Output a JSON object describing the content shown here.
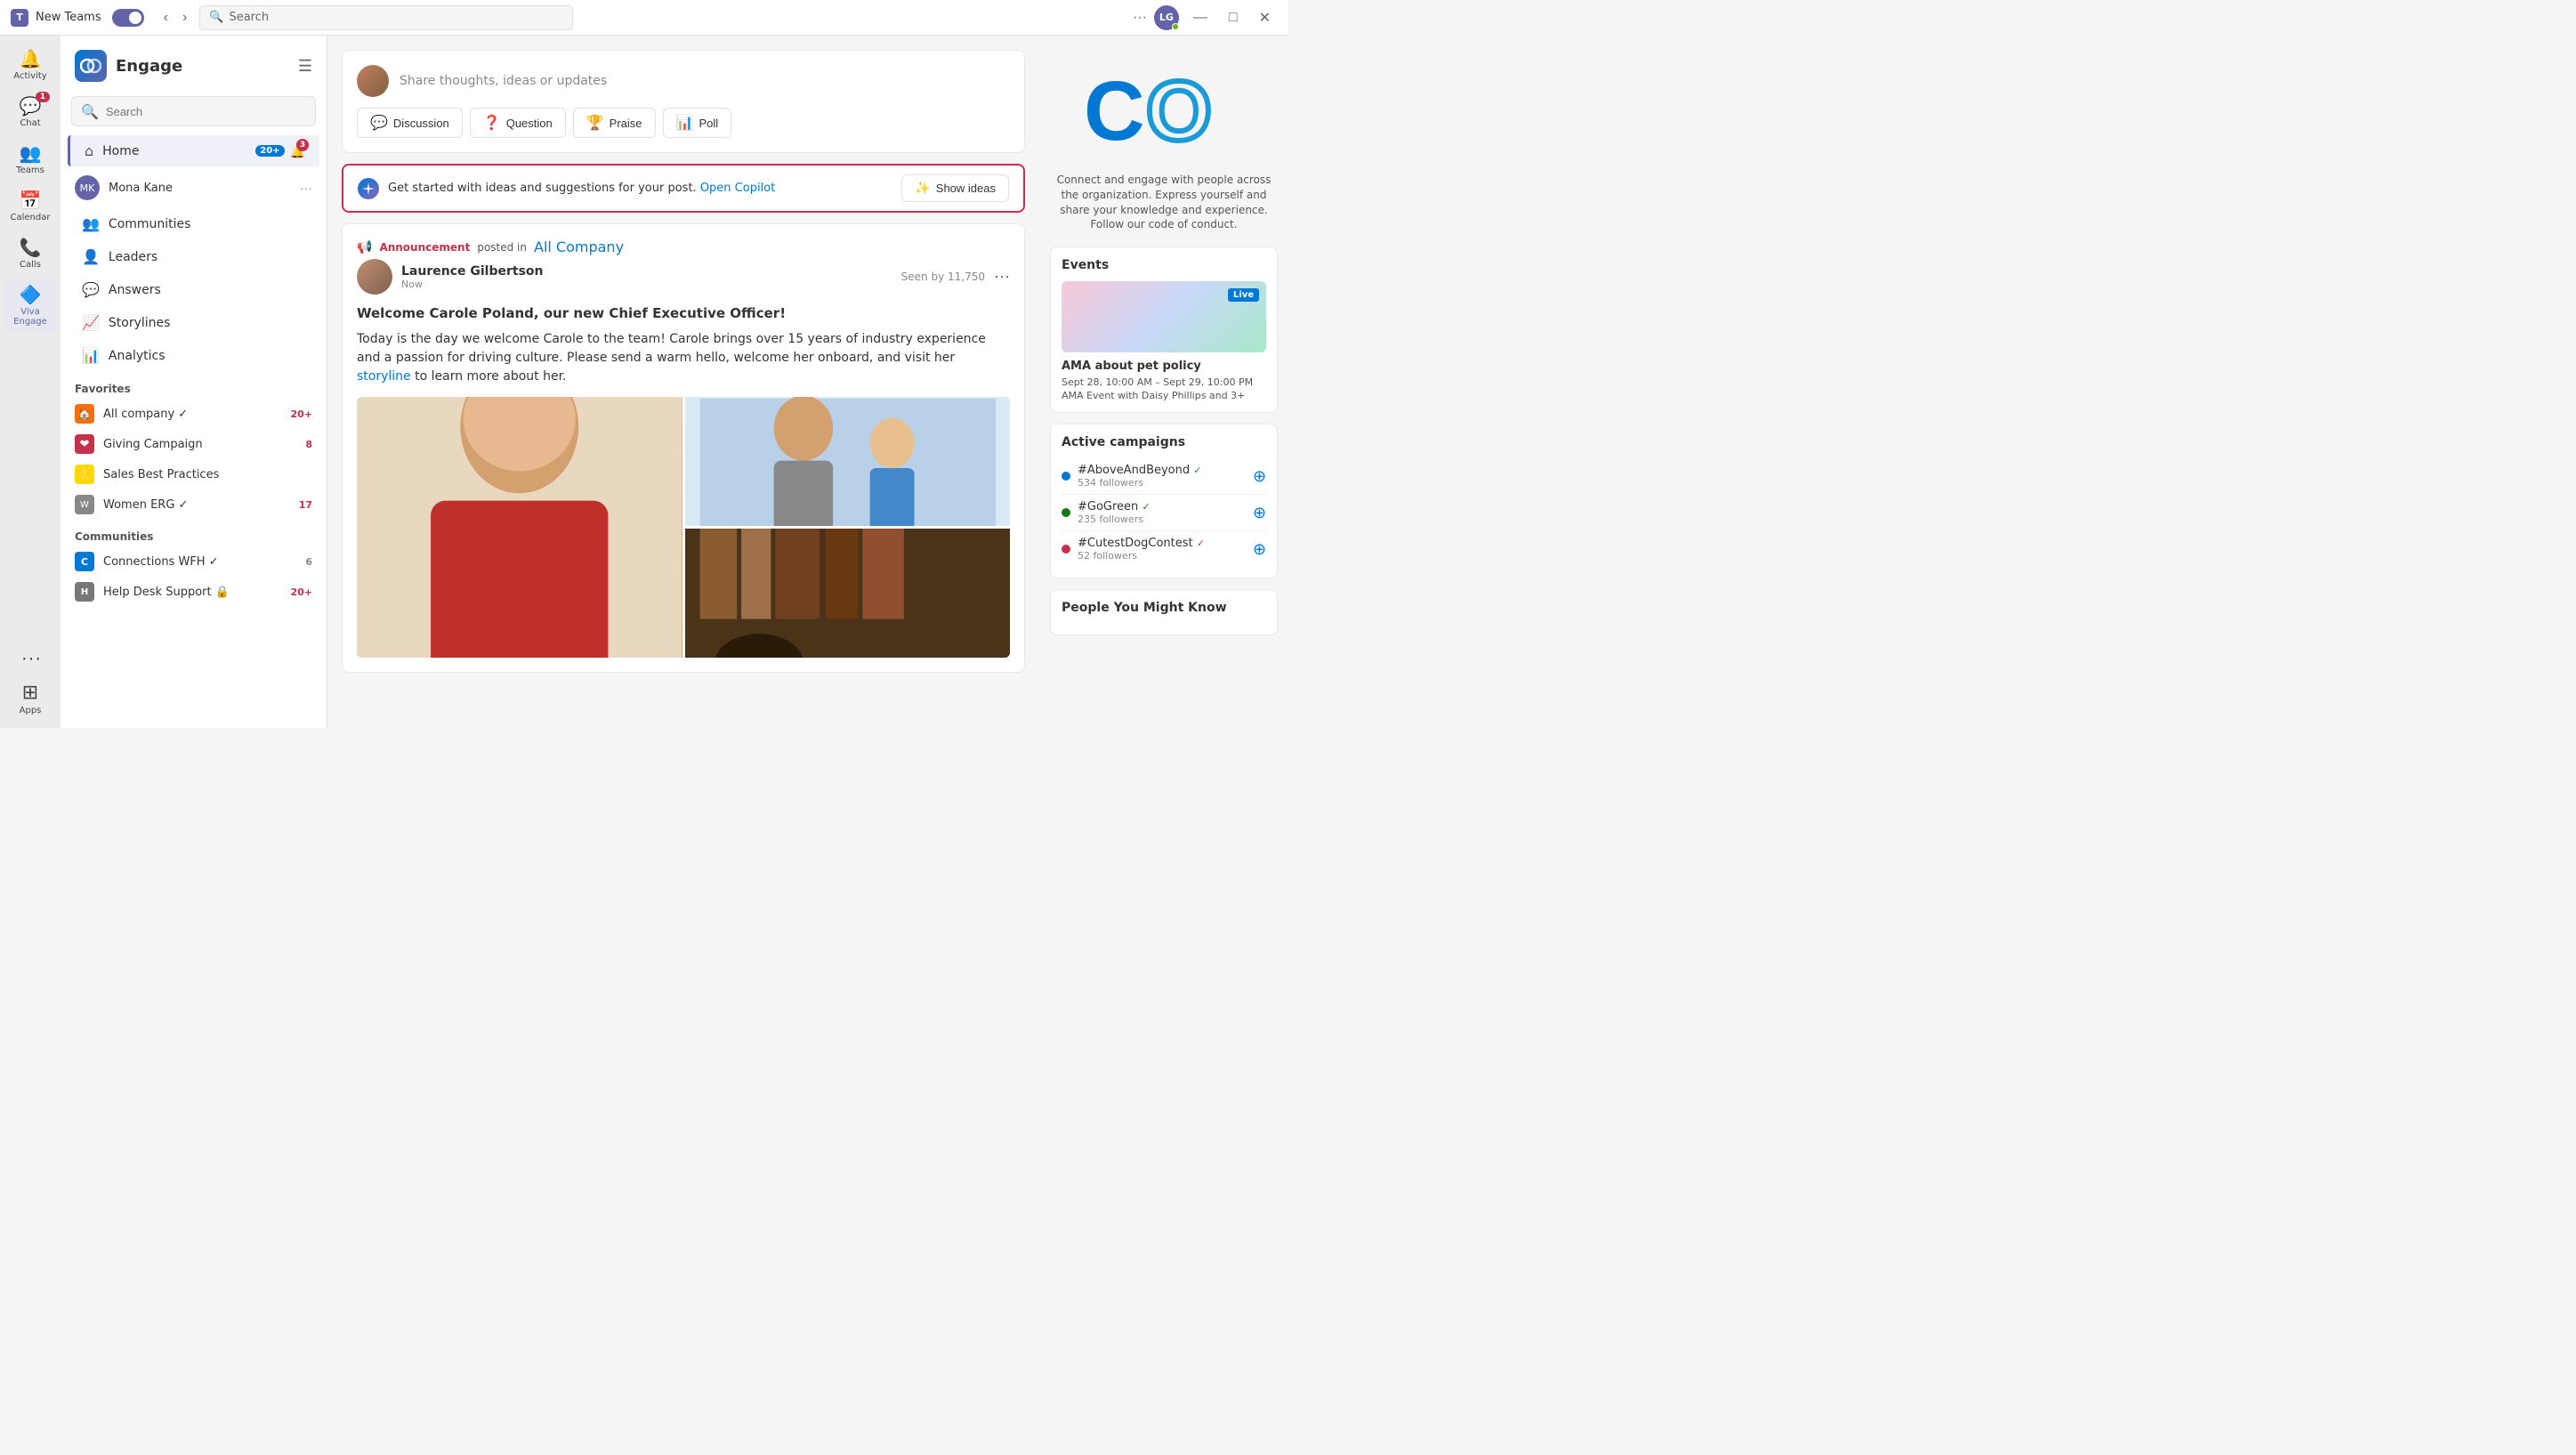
{
  "titleBar": {
    "appName": "New Teams",
    "searchPlaceholder": "Search",
    "avatarInitials": "LG",
    "minimize": "—",
    "maximize": "□",
    "close": "✕",
    "more": "···"
  },
  "leftRail": {
    "items": [
      {
        "id": "activity",
        "label": "Activity",
        "icon": "🔔",
        "badge": null
      },
      {
        "id": "chat",
        "label": "Chat",
        "icon": "💬",
        "badge": "1"
      },
      {
        "id": "teams",
        "label": "Teams",
        "icon": "👥",
        "badge": null
      },
      {
        "id": "calendar",
        "label": "Calendar",
        "icon": "📅",
        "badge": null
      },
      {
        "id": "calls",
        "label": "Calls",
        "icon": "📞",
        "badge": null
      },
      {
        "id": "viva-engage",
        "label": "Viva Engage",
        "icon": "🔷",
        "badge": null
      }
    ],
    "bottomItems": [
      {
        "id": "more",
        "label": "···",
        "icon": "···",
        "badge": null
      },
      {
        "id": "apps",
        "label": "Apps",
        "icon": "+",
        "badge": null
      }
    ]
  },
  "sidebar": {
    "title": "Engage",
    "searchPlaceholder": "Search",
    "navItems": [
      {
        "id": "home",
        "label": "Home",
        "icon": "⌂",
        "badgeCount": "20+",
        "bellCount": "3",
        "active": true
      },
      {
        "id": "communities",
        "label": "Communities",
        "icon": "👥",
        "badge": null
      },
      {
        "id": "leaders",
        "label": "Leaders",
        "icon": "👤",
        "badge": null
      },
      {
        "id": "answers",
        "label": "Answers",
        "icon": "💬",
        "badge": null
      },
      {
        "id": "storylines",
        "label": "Storylines",
        "icon": "📈",
        "badge": null
      },
      {
        "id": "analytics",
        "label": "Analytics",
        "icon": "📊",
        "badge": null
      }
    ],
    "user": {
      "name": "Mona Kane",
      "avatar": ""
    },
    "favorites": {
      "title": "Favorites",
      "items": [
        {
          "id": "all-company",
          "name": "All company",
          "icon": "🏠",
          "iconBg": "orange",
          "badgeCount": "20+",
          "verified": true
        },
        {
          "id": "giving-campaign",
          "name": "Giving Campaign",
          "icon": "❤",
          "iconBg": "red",
          "badgeCount": "8"
        },
        {
          "id": "sales-best",
          "name": "Sales Best Practices",
          "icon": "⭐",
          "iconBg": "yellow",
          "badgeCount": null
        },
        {
          "id": "women-erg",
          "name": "Women ERG",
          "icon": "👤",
          "iconBg": "gray",
          "badgeCount": "17",
          "verified": true
        }
      ]
    },
    "communities": {
      "title": "Communities",
      "items": [
        {
          "id": "connections-wfh",
          "name": "Connections WFH",
          "icon": "C",
          "iconBg": "#0078d4",
          "badgeCount": "6",
          "verified": true
        },
        {
          "id": "help-desk",
          "name": "Help Desk Support",
          "icon": "H",
          "iconBg": "#555",
          "badgeCount": "20+",
          "locked": true
        }
      ]
    }
  },
  "composer": {
    "placeholder": "Share thoughts, ideas or updates",
    "buttons": [
      {
        "id": "discussion",
        "label": "Discussion",
        "color": "orange"
      },
      {
        "id": "question",
        "label": "Question",
        "color": "blue"
      },
      {
        "id": "praise",
        "label": "Praise",
        "color": "purple"
      },
      {
        "id": "poll",
        "label": "Poll",
        "color": "green"
      }
    ]
  },
  "copilotBar": {
    "text": "Get started with ideas and suggestions for your post.",
    "linkText": "Open Copilot",
    "showIdeasLabel": "Show ideas"
  },
  "post": {
    "announcementLabel": "Announcement",
    "postedIn": "posted in",
    "community": "All Company",
    "authorName": "Laurence Gilbertson",
    "time": "Now",
    "seenBy": "Seen by 11,750",
    "title": "Welcome Carole Poland, our new Chief Executive Officer!",
    "body": "Today is the day we welcome Carole to the team! Carole brings over 15 years of industry experience and a passion for driving culture. Please send a warm hello, welcome her onboard, and visit her",
    "storylineLink": "storyline",
    "bodyEnd": "to learn more about her."
  },
  "rightPanel": {
    "coLetters": "CO",
    "description": "Connect and engage with people across the organization. Express yourself and share your knowledge and experience. Follow our code of conduct.",
    "events": {
      "title": "Events",
      "items": [
        {
          "id": "ama-pet",
          "title": "AMA about pet policy",
          "date": "Sept 28, 10:00 AM – Sept 29, 10:00 PM",
          "desc": "AMA Event with Daisy Phillips and 3+",
          "live": true,
          "liveLabel": "Live"
        }
      ]
    },
    "campaigns": {
      "title": "Active campaigns",
      "items": [
        {
          "id": "above-beyond",
          "name": "#AboveAndBeyond",
          "followers": "534 followers",
          "dotColor": "blue",
          "verified": true
        },
        {
          "id": "go-green",
          "name": "#GoGreen",
          "followers": "235 followers",
          "dotColor": "green",
          "verified": true
        },
        {
          "id": "cutest-dog",
          "name": "#CutestDogContest",
          "followers": "52 followers",
          "dotColor": "red",
          "verified": true
        }
      ]
    },
    "peopleYouMightKnow": {
      "title": "People You Might Know"
    }
  }
}
